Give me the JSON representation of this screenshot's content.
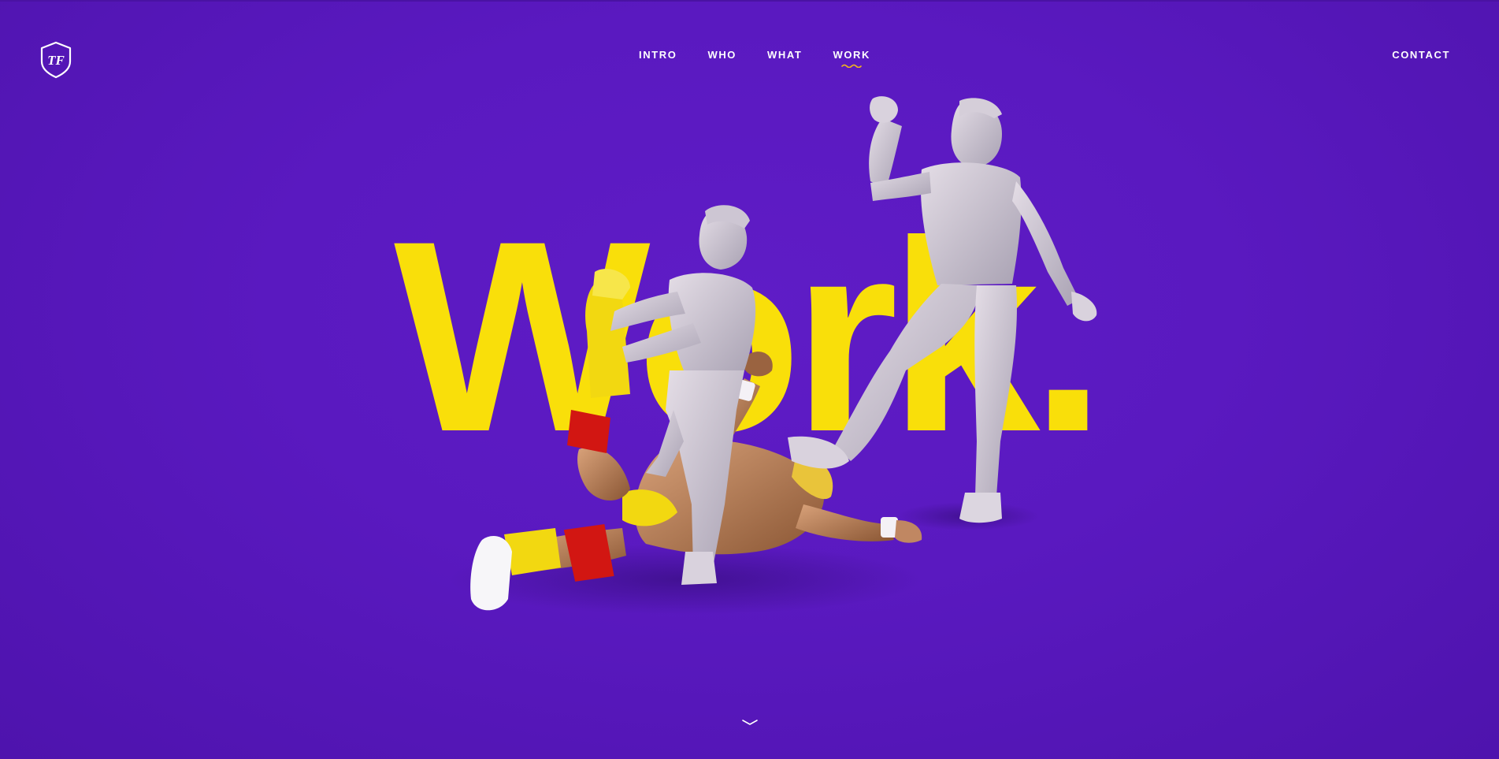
{
  "header": {
    "logo_text": "TF",
    "nav": [
      {
        "label": "INTRO",
        "active": false
      },
      {
        "label": "WHO",
        "active": false
      },
      {
        "label": "WHAT",
        "active": false
      },
      {
        "label": "WORK",
        "active": true
      }
    ],
    "contact_label": "CONTACT"
  },
  "hero": {
    "headline": "Work."
  },
  "colors": {
    "background": "#5b1bc2",
    "accent_yellow": "#f9df0a",
    "nav_text": "#ffffff",
    "active_underline": "#f2b51c"
  },
  "icons": {
    "logo": "tf-shield-logo-icon",
    "scroll": "chevron-down-icon"
  }
}
